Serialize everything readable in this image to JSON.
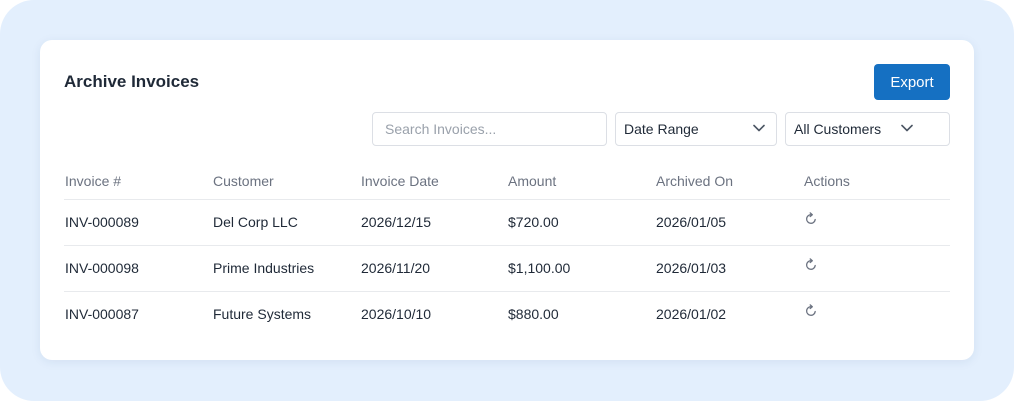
{
  "page": {
    "title": "Archive Invoices",
    "export_label": "Export"
  },
  "filters": {
    "search_placeholder": "Search Invoices...",
    "date_range": "Date Range",
    "customers": "All Customers"
  },
  "table": {
    "headers": [
      "Invoice #",
      "Customer",
      "Invoice Date",
      "Amount",
      "Archived On",
      "Actions"
    ],
    "rows": [
      {
        "invoice": "INV-000089",
        "customer": "Del Corp LLC",
        "invoice_date": "2026/12/15",
        "amount": "$720.00",
        "archived_on": "2026/01/05",
        "action_icon": "restore-icon"
      },
      {
        "invoice": "INV-000098",
        "customer": "Prime Industries",
        "invoice_date": "2026/11/20",
        "amount": "$1,100.00",
        "archived_on": "2026/01/03",
        "action_icon": "restore-icon"
      },
      {
        "invoice": "INV-000087",
        "customer": "Future Systems",
        "invoice_date": "2026/10/10",
        "amount": "$880.00",
        "archived_on": "2026/01/02",
        "action_icon": "restore-icon"
      }
    ]
  },
  "colors": {
    "accent": "#1570c2",
    "background": "#e3effd"
  }
}
